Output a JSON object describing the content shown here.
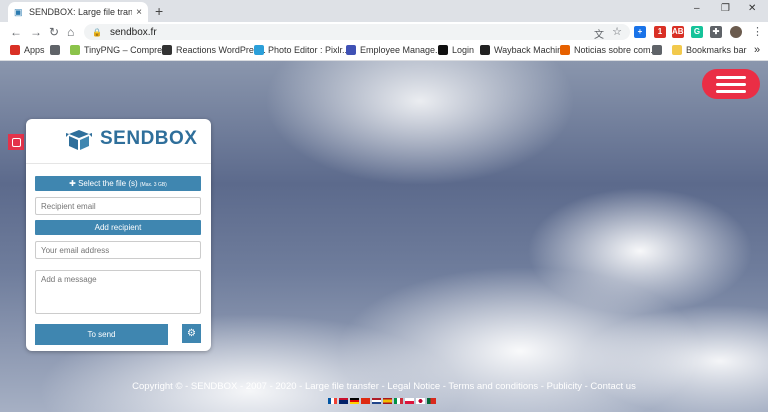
{
  "browser": {
    "tab_title": "SENDBOX: Large file transfer, sy",
    "tab_close": "×",
    "new_tab": "+",
    "win_min": "–",
    "win_max": "❐",
    "win_close": "✕",
    "url": "sendbox.fr",
    "extensions": [
      {
        "icon": "plus-extension-icon",
        "label": "+",
        "color": "#1a73e8"
      },
      {
        "icon": "badge-extension-icon",
        "label": "1",
        "color": "#d93025"
      },
      {
        "icon": "adblock-icon",
        "label": "ABP",
        "color": "#d93025"
      },
      {
        "icon": "grammarly-icon",
        "label": "G",
        "color": "#15c39a"
      },
      {
        "icon": "puzzle-icon",
        "label": "✚",
        "color": "#5f6368"
      }
    ]
  },
  "bookmarks": [
    {
      "label": "Apps",
      "icon": "apps-grid-icon",
      "color": "#d93025"
    },
    {
      "label": "",
      "icon": "globe-icon",
      "color": "#5f6368"
    },
    {
      "label": "TinyPNG – Compre...",
      "icon": "tinypng-icon",
      "color": "#8bc34a"
    },
    {
      "label": "Reactions WordPres...",
      "icon": "wordpress-icon",
      "color": "#333333"
    },
    {
      "label": "Photo Editor : Pixlr...",
      "icon": "pixlr-icon",
      "color": "#2b9fd9"
    },
    {
      "label": "Employee Manage...",
      "icon": "employee-icon",
      "color": "#3f51b5"
    },
    {
      "label": "Login",
      "icon": "login-icon",
      "color": "#111111"
    },
    {
      "label": "Wayback Machine",
      "icon": "wayback-icon",
      "color": "#222222"
    },
    {
      "label": "Noticias sobre com...",
      "icon": "firefox-icon",
      "color": "#e66000"
    },
    {
      "label": "",
      "icon": "globe-icon",
      "color": "#5f6368"
    },
    {
      "label": "Bookmarks bar",
      "icon": "folder-icon",
      "color": "#f2c94c"
    }
  ],
  "bookmarks_more": "»",
  "card": {
    "brand": "SENDBOX",
    "select_files": "Select the file (s)",
    "select_files_max": "(Max. 3 GB)",
    "recipient_placeholder": "Recipient email",
    "add_recipient": "Add recipient",
    "your_email_placeholder": "Your email address",
    "message_placeholder": "Add a message",
    "send": "To send",
    "settings_icon": "⚙"
  },
  "footer": "Copyright © - SENDBOX - 2007 - 2020 - Large file transfer - Legal Notice - Terms and conditions - Publicity - Contact us",
  "colors": {
    "accent": "#3f86b0",
    "menu": "#ea2e45",
    "brand": "#2f6f9b"
  }
}
